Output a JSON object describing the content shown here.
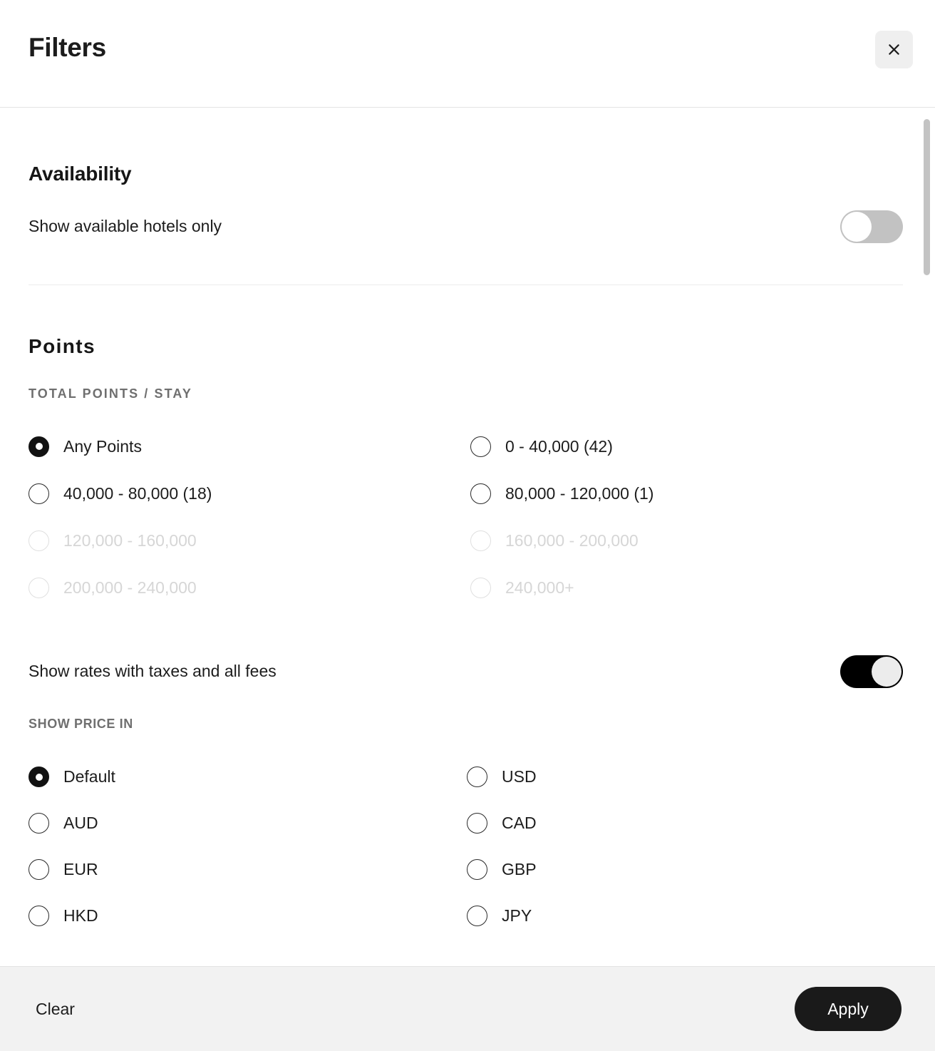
{
  "header": {
    "title": "Filters",
    "close_icon": "close-icon"
  },
  "availability": {
    "heading": "Availability",
    "toggle": {
      "label": "Show available hotels only",
      "state": "off"
    }
  },
  "points": {
    "heading": "Points",
    "group_label": "Total points / stay",
    "options": [
      {
        "label": "Any Points",
        "state": "selected"
      },
      {
        "label": "0 - 40,000 (42)",
        "state": "enabled"
      },
      {
        "label": "40,000 - 80,000 (18)",
        "state": "enabled"
      },
      {
        "label": "80,000 - 120,000 (1)",
        "state": "enabled"
      },
      {
        "label": "120,000 - 160,000",
        "state": "disabled"
      },
      {
        "label": "160,000 - 200,000",
        "state": "disabled"
      },
      {
        "label": "200,000 - 240,000",
        "state": "disabled"
      },
      {
        "label": "240,000+",
        "state": "disabled"
      }
    ],
    "taxes_toggle": {
      "label": "Show rates with taxes and all fees",
      "state": "on"
    }
  },
  "currency": {
    "group_label": "Show price in",
    "options": [
      {
        "label": "Default",
        "state": "selected"
      },
      {
        "label": "USD",
        "state": "enabled"
      },
      {
        "label": "AUD",
        "state": "enabled"
      },
      {
        "label": "CAD",
        "state": "enabled"
      },
      {
        "label": "EUR",
        "state": "enabled"
      },
      {
        "label": "GBP",
        "state": "enabled"
      },
      {
        "label": "HKD",
        "state": "enabled"
      },
      {
        "label": "JPY",
        "state": "enabled"
      }
    ]
  },
  "footer": {
    "clear_label": "Clear",
    "apply_label": "Apply"
  },
  "colors": {
    "accent": "#1a1a1a",
    "toggle_off_track": "#c2c2c2",
    "toggle_on_track": "#000000",
    "footer_bg": "#f2f2f2",
    "disabled_text": "#d6d6d6"
  }
}
